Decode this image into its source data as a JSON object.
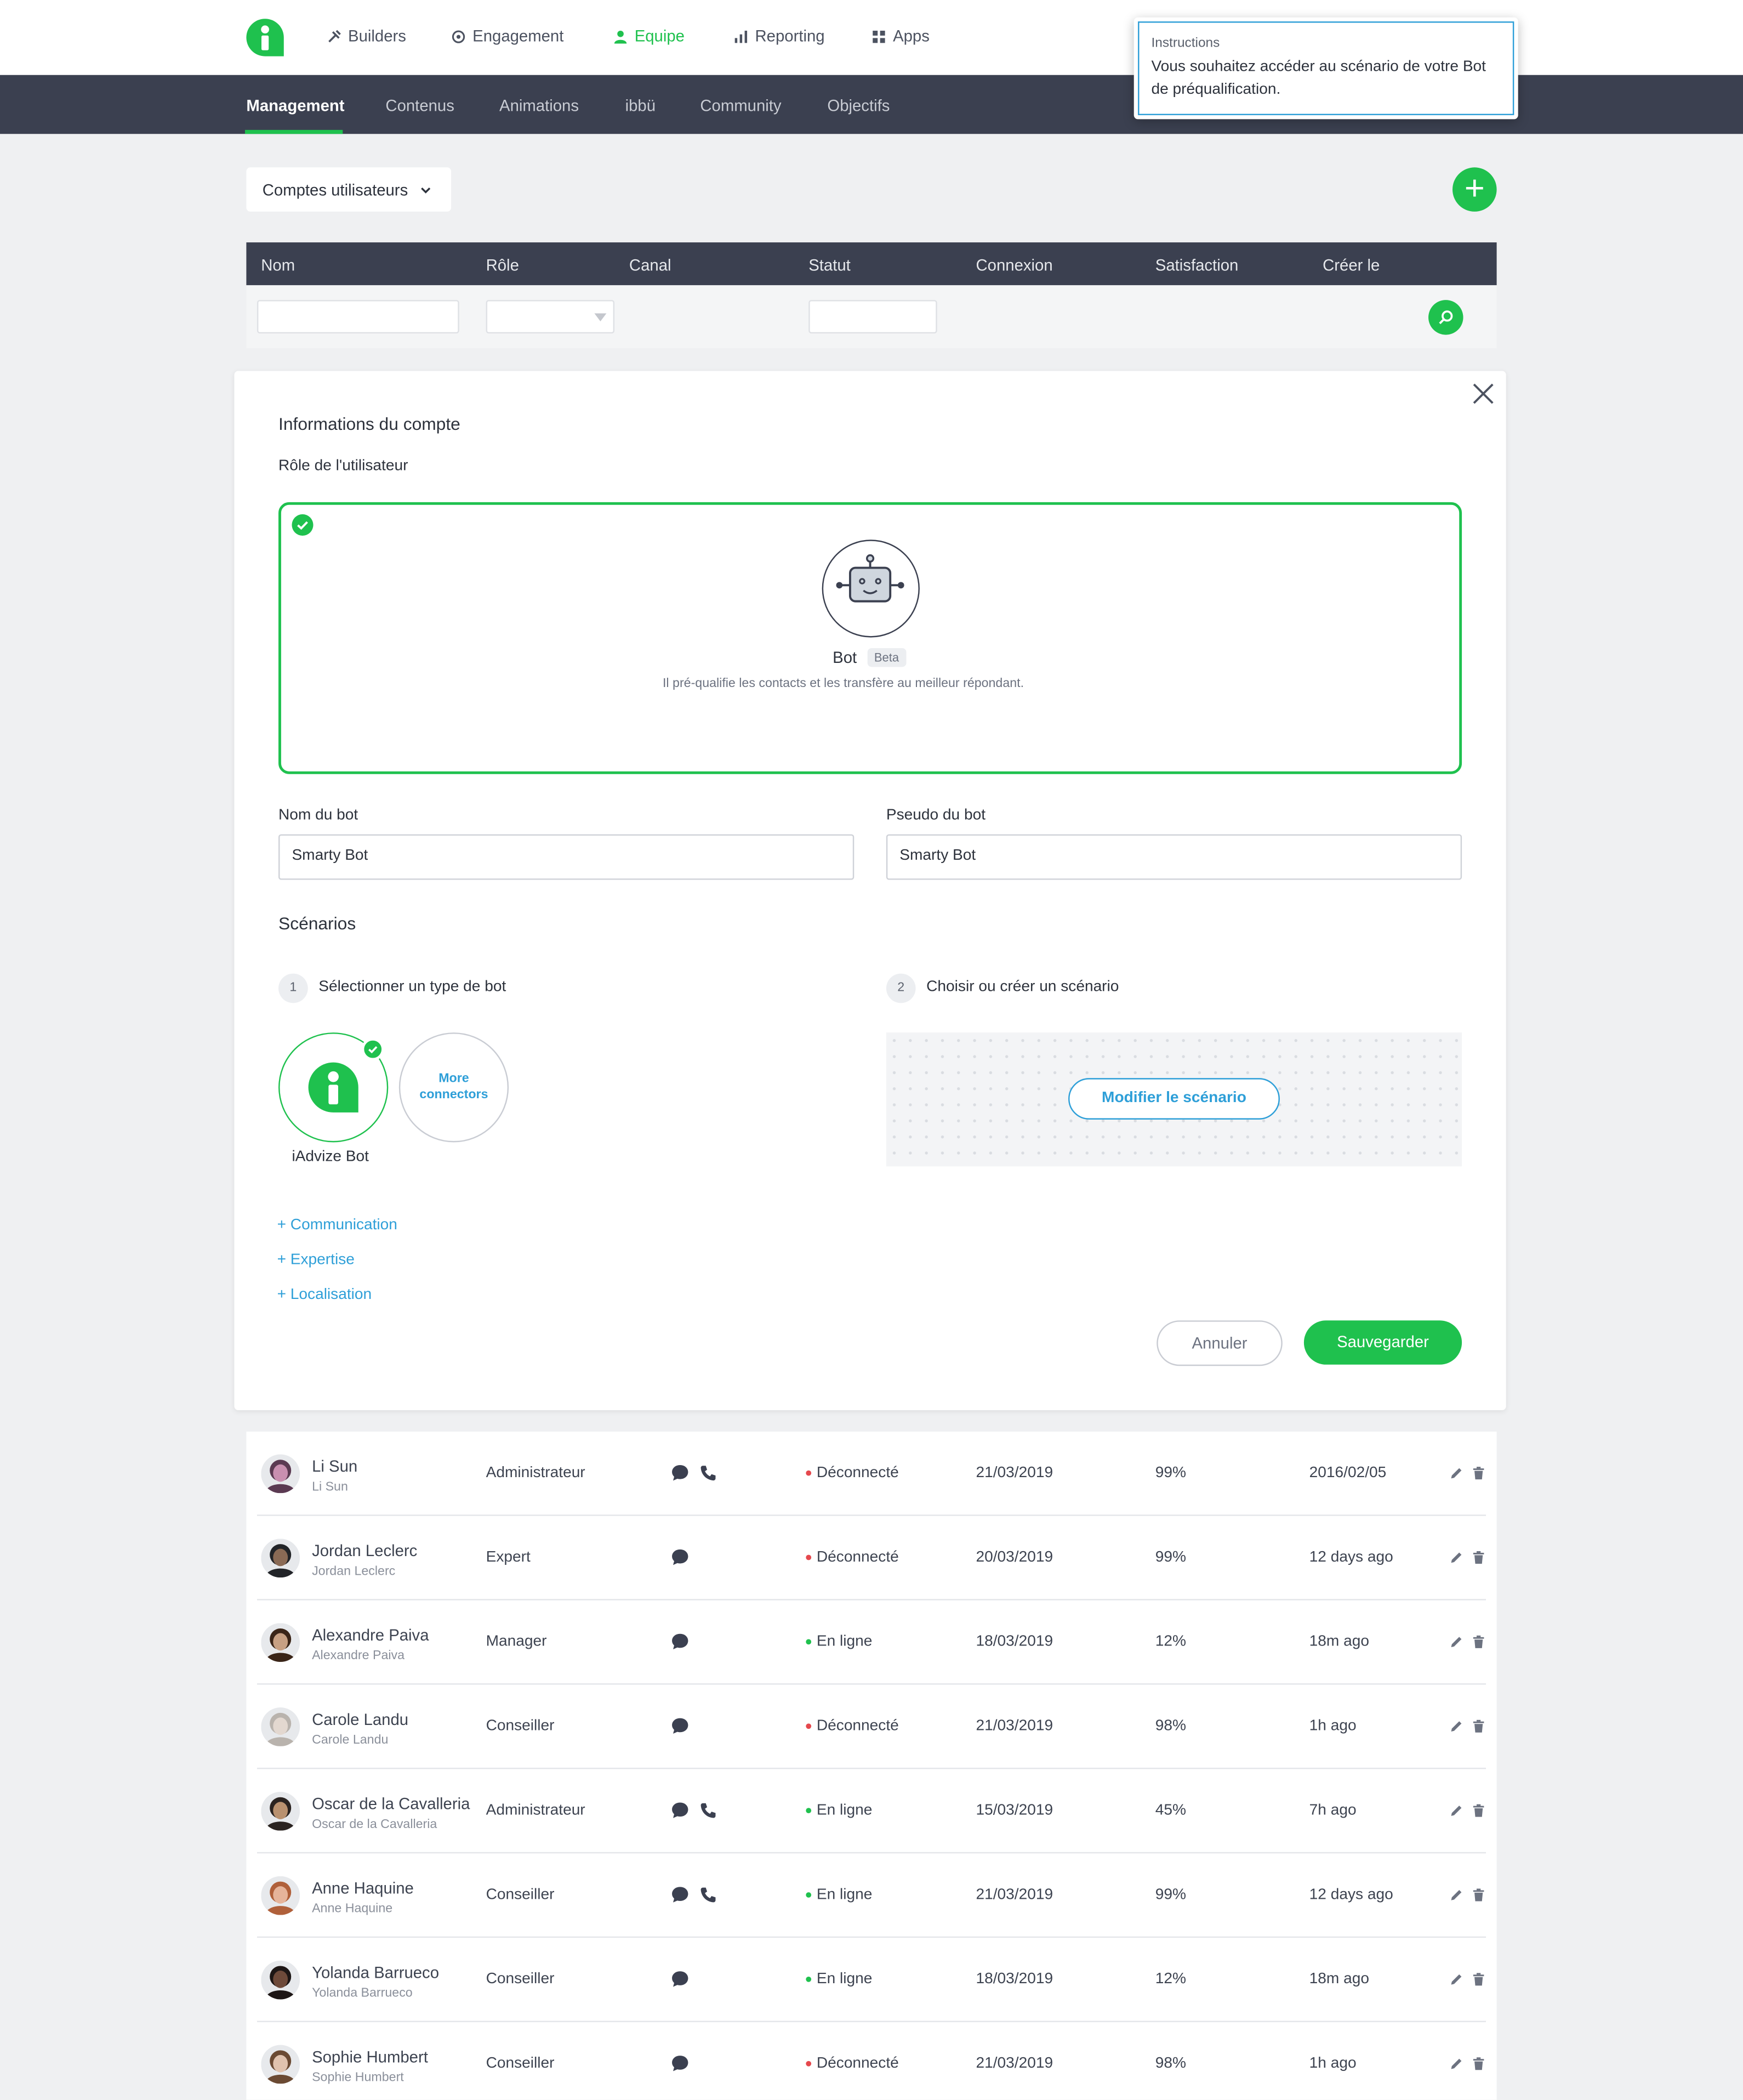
{
  "nav": {
    "items": [
      {
        "label": "Builders",
        "icon": "tools-icon"
      },
      {
        "label": "Engagement",
        "icon": "target-icon"
      },
      {
        "label": "Equipe",
        "icon": "user-icon",
        "active": true
      },
      {
        "label": "Reporting",
        "icon": "bar-chart-icon"
      },
      {
        "label": "Apps",
        "icon": "grid-icon"
      }
    ]
  },
  "instructions": {
    "title": "Instructions",
    "text": "Vous souhaitez accéder au scénario de votre Bot de préqualification."
  },
  "subnav": {
    "items": [
      "Management",
      "Contenus",
      "Animations",
      "ibbü",
      "Community",
      "Objectifs"
    ],
    "active": "Management"
  },
  "accounts_dropdown": "Comptes utilisateurs",
  "table": {
    "columns": [
      "Nom",
      "Rôle",
      "Canal",
      "Statut",
      "Connexion",
      "Satisfaction",
      "Créer le"
    ]
  },
  "modal": {
    "title": "Informations du compte",
    "role_label": "Rôle de l'utilisateur",
    "role_name": "Bot",
    "role_badge": "Beta",
    "role_desc": "Il pré-qualifie les contacts et les transfère au meilleur répondant.",
    "bot_name_label": "Nom du bot",
    "bot_name_value": "Smarty Bot",
    "bot_pseudo_label": "Pseudo du bot",
    "bot_pseudo_value": "Smarty Bot",
    "scenarios_title": "Scénarios",
    "step1_num": "1",
    "step1_label": "Sélectionner un type de bot",
    "step2_num": "2",
    "step2_label": "Choisir ou créer un scénario",
    "connector_name": "iAdvize Bot",
    "more_connectors": "More connectors",
    "edit_scenario": "Modifier le scénario",
    "links": [
      "+ Communication",
      "+ Expertise",
      "+ Localisation"
    ],
    "cancel": "Annuler",
    "save": "Sauvegarder"
  },
  "users": [
    {
      "name": "Li Sun",
      "sub": "Li Sun",
      "role": "Administrateur",
      "phone": true,
      "status": "Déconnecté",
      "online": false,
      "connexion": "21/03/2019",
      "satisfaction": "99%",
      "created": "2016/02/05",
      "skin": "#c98fb0",
      "hair": "#5b3a52"
    },
    {
      "name": "Jordan Leclerc",
      "sub": "Jordan Leclerc",
      "role": "Expert",
      "phone": false,
      "status": "Déconnecté",
      "online": false,
      "connexion": "20/03/2019",
      "satisfaction": "99%",
      "created": "12 days ago",
      "skin": "#8a6a55",
      "hair": "#222428"
    },
    {
      "name": "Alexandre Paiva",
      "sub": "Alexandre Paiva",
      "role": "Manager",
      "phone": false,
      "status": "En ligne",
      "online": true,
      "connexion": "18/03/2019",
      "satisfaction": "12%",
      "created": "18m ago",
      "skin": "#c7a083",
      "hair": "#3a2518"
    },
    {
      "name": "Carole Landu",
      "sub": "Carole Landu",
      "role": "Conseiller",
      "phone": false,
      "status": "Déconnecté",
      "online": false,
      "connexion": "21/03/2019",
      "satisfaction": "98%",
      "created": "1h ago",
      "skin": "#e3d8d0",
      "hair": "#b9b3ad"
    },
    {
      "name": "Oscar de la Cavalleria",
      "sub": "Oscar de la Cavalleria",
      "role": "Administrateur",
      "phone": true,
      "status": "En ligne",
      "online": true,
      "connexion": "15/03/2019",
      "satisfaction": "45%",
      "created": "7h ago",
      "skin": "#b9916f",
      "hair": "#2a2320"
    },
    {
      "name": "Anne Haquine",
      "sub": "Anne Haquine",
      "role": "Conseiller",
      "phone": true,
      "status": "En ligne",
      "online": true,
      "connexion": "21/03/2019",
      "satisfaction": "99%",
      "created": "12 days ago",
      "skin": "#e6b49a",
      "hair": "#b0603a"
    },
    {
      "name": "Yolanda Barrueco",
      "sub": "Yolanda Barrueco",
      "role": "Conseiller",
      "phone": false,
      "status": "En ligne",
      "online": true,
      "connexion": "18/03/2019",
      "satisfaction": "12%",
      "created": "18m ago",
      "skin": "#6e4a3a",
      "hair": "#1d1615"
    },
    {
      "name": "Sophie Humbert",
      "sub": "Sophie Humbert",
      "role": "Conseiller",
      "phone": false,
      "status": "Déconnecté",
      "online": false,
      "connexion": "21/03/2019",
      "satisfaction": "98%",
      "created": "1h ago",
      "skin": "#e0c2ae",
      "hair": "#6b4a33"
    }
  ],
  "colors": {
    "green": "#1fc14e",
    "blue": "#2e9fd8",
    "dark": "#3b4050",
    "offline": "#e5484d",
    "online": "#1fc14e"
  }
}
